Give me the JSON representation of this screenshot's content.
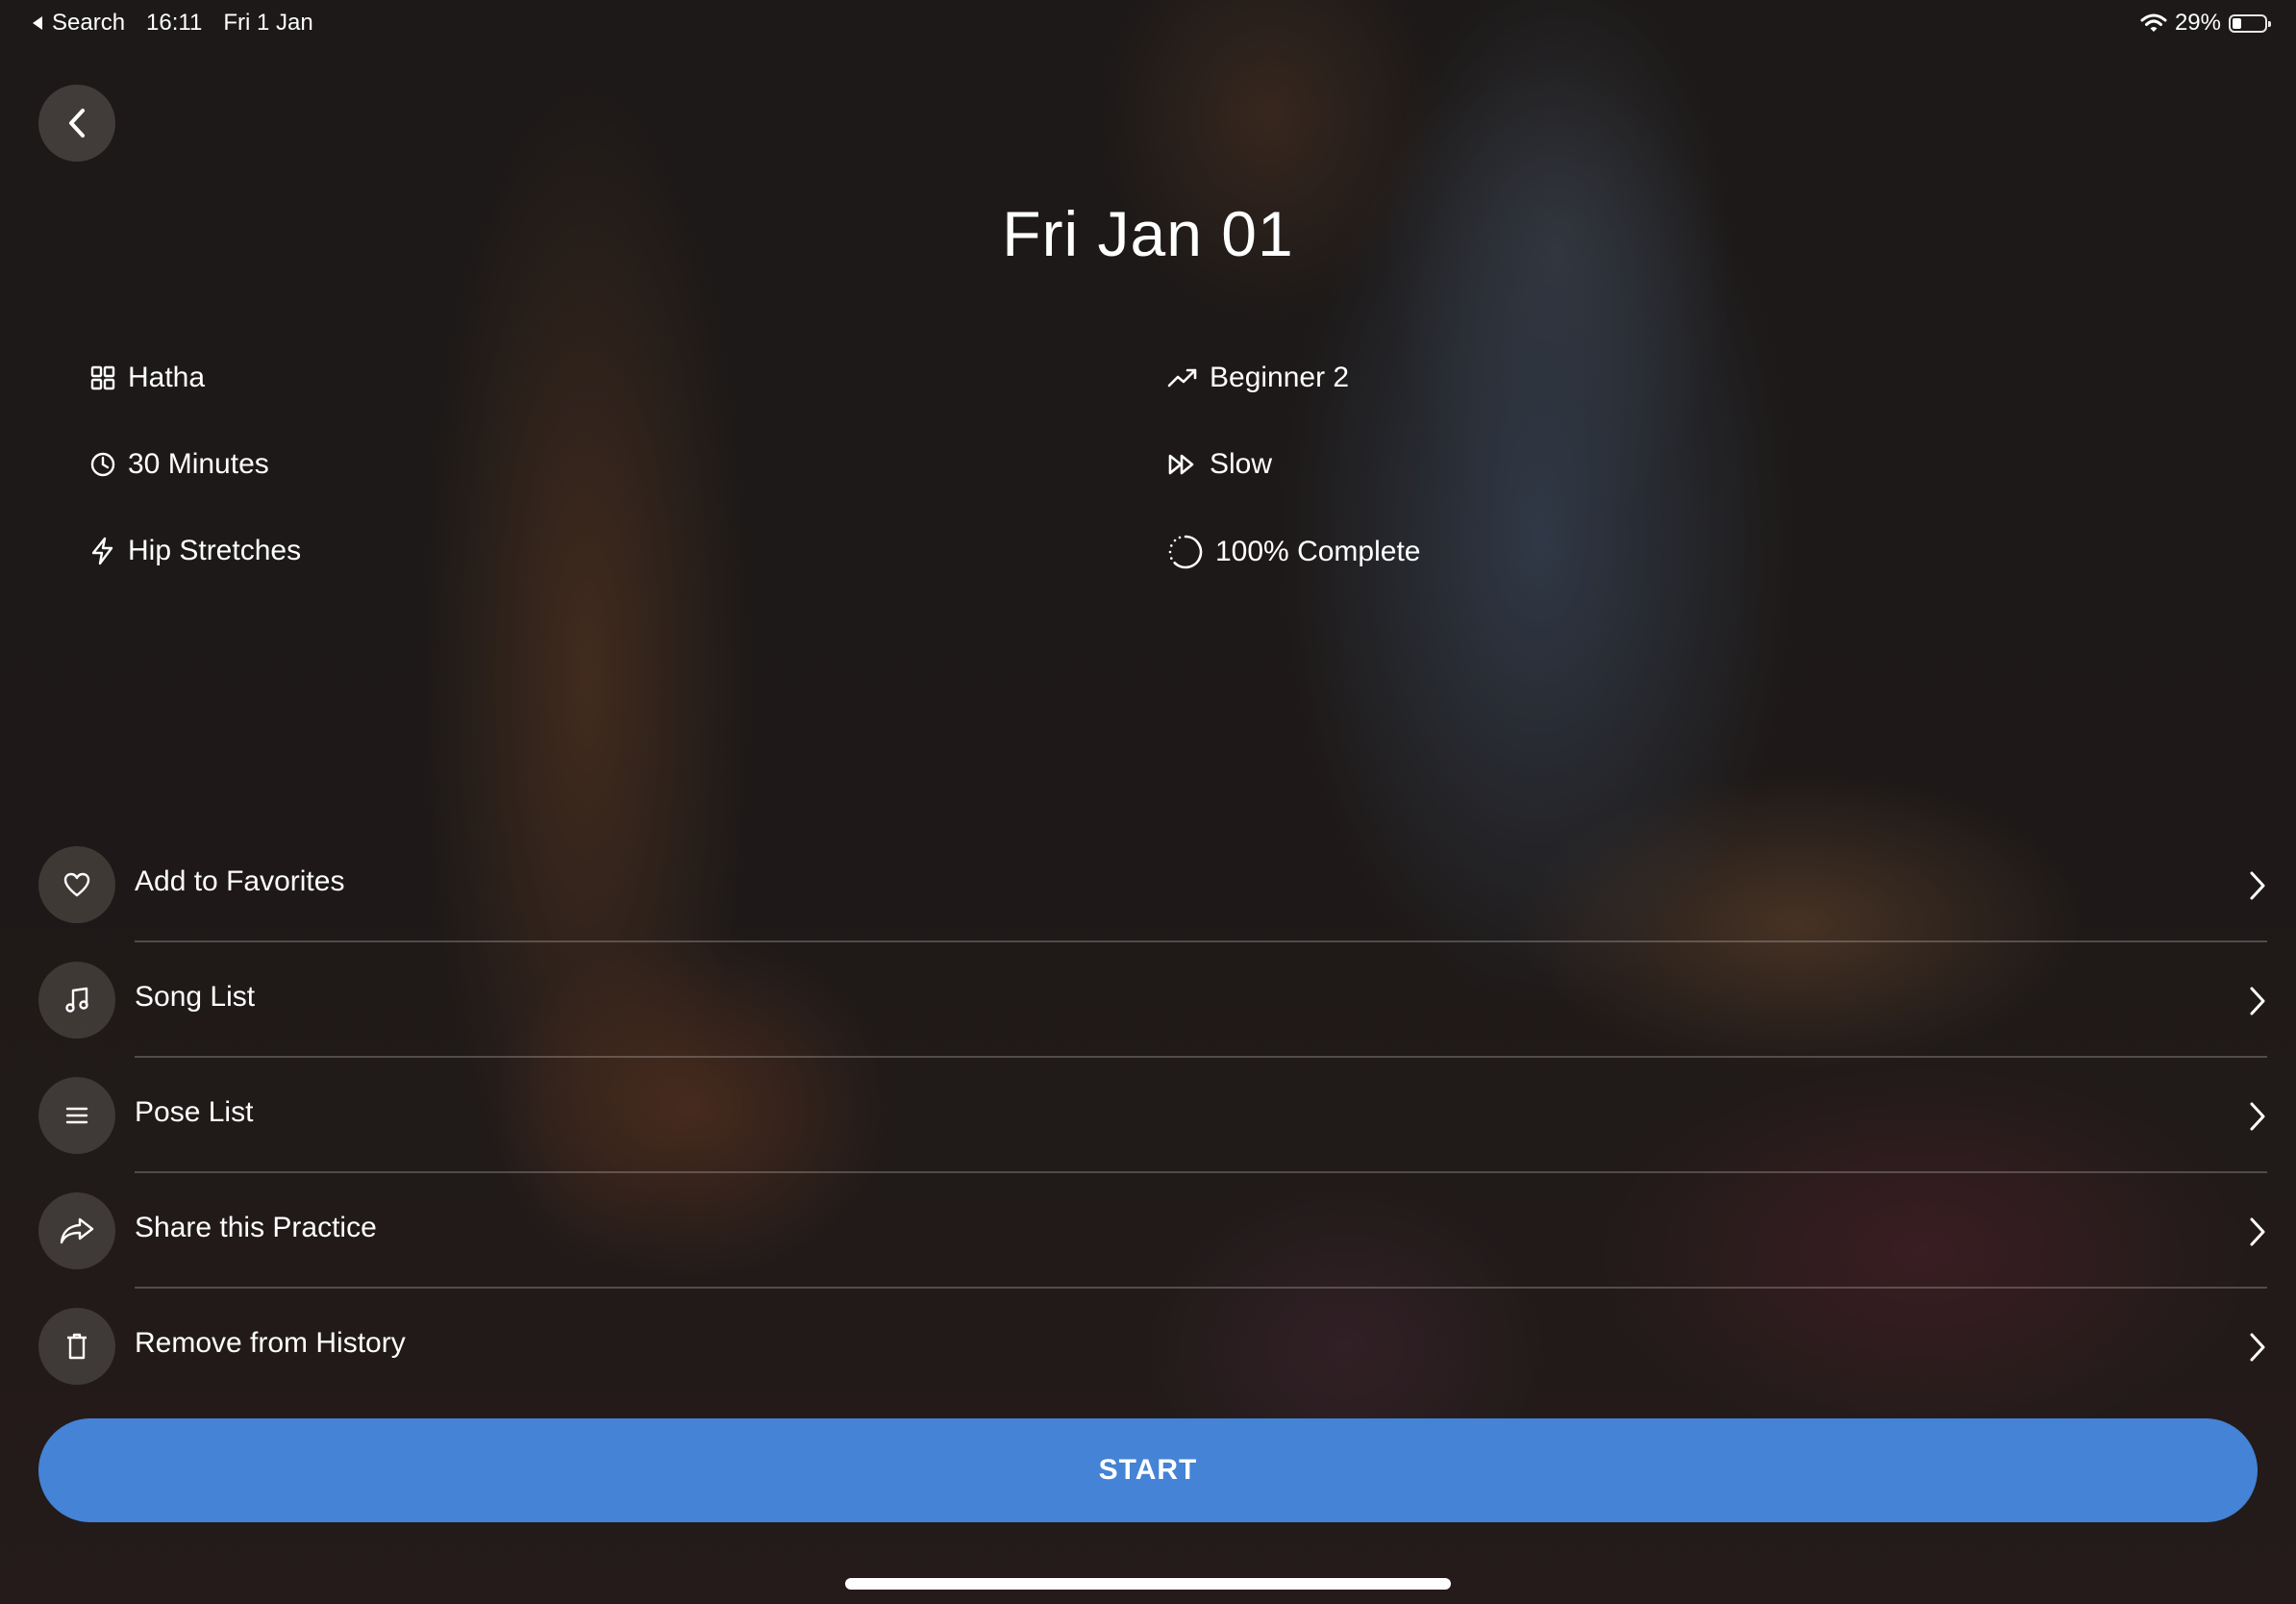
{
  "status_bar": {
    "back_app": "Search",
    "time": "16:11",
    "date": "Fri 1 Jan",
    "battery": "29%",
    "battery_level": 0.29
  },
  "page": {
    "title": "Fri Jan 01"
  },
  "details": {
    "style": {
      "label": "Hatha",
      "icon": "grid-icon"
    },
    "duration": {
      "label": "30 Minutes",
      "icon": "clock-icon"
    },
    "focus": {
      "label": "Hip Stretches",
      "icon": "lightning-icon"
    },
    "level": {
      "label": "Beginner 2",
      "icon": "trend-up-icon"
    },
    "pace": {
      "label": "Slow",
      "icon": "fast-forward-icon"
    },
    "progress": {
      "label": "100% Complete",
      "icon": "progress-circle-icon"
    }
  },
  "actions": [
    {
      "label": "Add to Favorites",
      "icon": "heart-icon"
    },
    {
      "label": "Song List",
      "icon": "music-note-icon"
    },
    {
      "label": "Pose List",
      "icon": "list-icon"
    },
    {
      "label": "Share this Practice",
      "icon": "share-icon"
    },
    {
      "label": "Remove from History",
      "icon": "trash-icon"
    }
  ],
  "start_button": {
    "label": "START"
  },
  "colors": {
    "accent": "#4483d5",
    "background": "#231d1b",
    "text": "#ffffff"
  }
}
